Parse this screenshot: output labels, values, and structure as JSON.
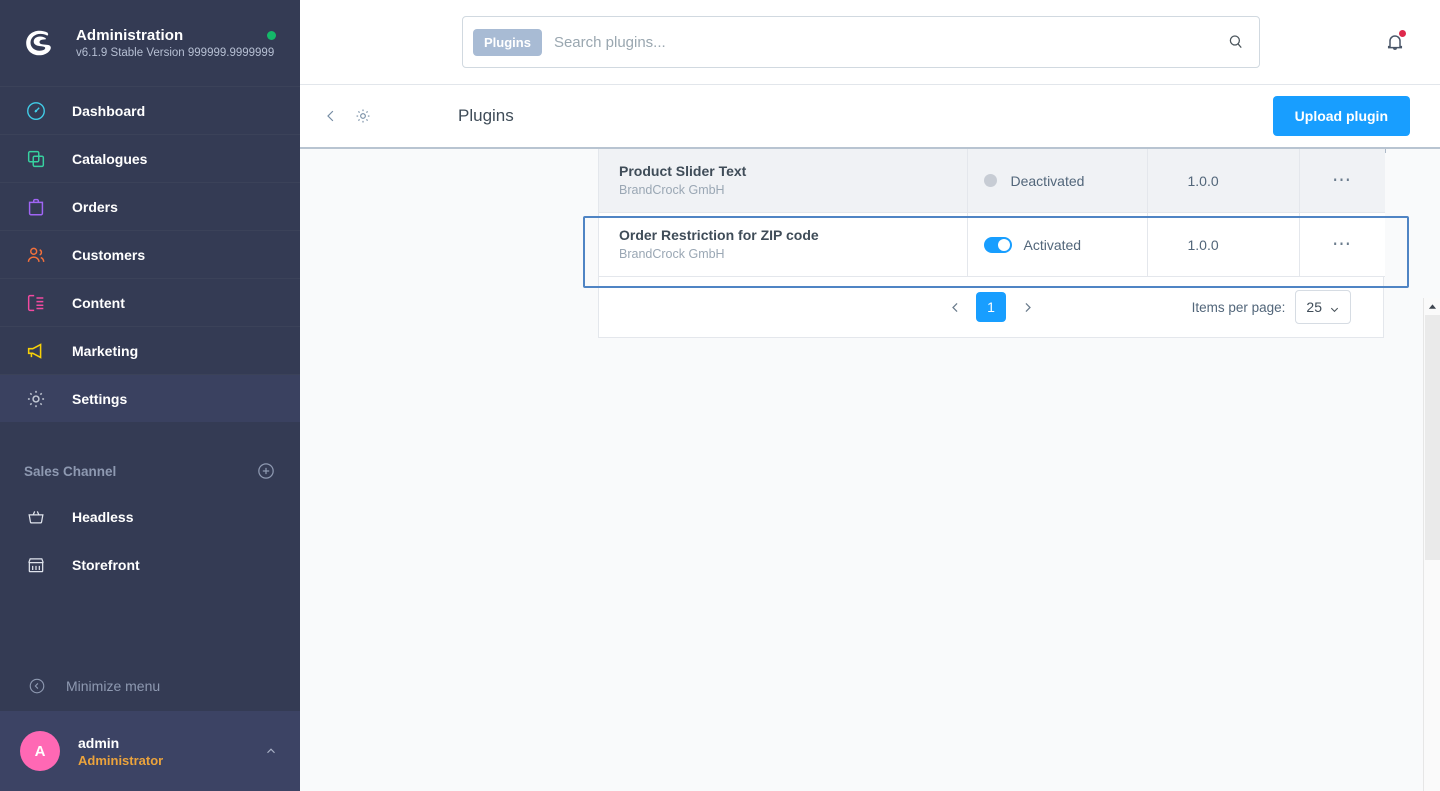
{
  "sidebar": {
    "brand": {
      "title": "Administration",
      "version": "v6.1.9 Stable Version 999999.9999999",
      "logo_icon": "shopware-logo-icon",
      "status_dot_color": "#14b869"
    },
    "nav_items": [
      {
        "label": "Dashboard",
        "icon": "dashboard-icon",
        "color": "#41cde8",
        "active": false
      },
      {
        "label": "Catalogues",
        "icon": "catalogues-icon",
        "color": "#37d1a0",
        "active": false
      },
      {
        "label": "Orders",
        "icon": "orders-icon",
        "color": "#a065f5",
        "active": false
      },
      {
        "label": "Customers",
        "icon": "customers-icon",
        "color": "#f3703b",
        "active": false
      },
      {
        "label": "Content",
        "icon": "content-icon",
        "color": "#f24aa0",
        "active": false
      },
      {
        "label": "Marketing",
        "icon": "marketing-icon",
        "color": "#f7d008",
        "active": false
      },
      {
        "label": "Settings",
        "icon": "gear-icon",
        "color": "#c4cad6",
        "active": true
      }
    ],
    "sales_channel": {
      "heading": "Sales Channel",
      "add_icon": "plus-circle-icon",
      "items": [
        {
          "label": "Headless",
          "icon": "headless-basket-icon"
        },
        {
          "label": "Storefront",
          "icon": "storefront-icon"
        }
      ]
    },
    "minimize": {
      "label": "Minimize menu",
      "icon": "collapse-left-icon"
    },
    "user": {
      "initial": "A",
      "name": "admin",
      "role": "Administrator",
      "chevron_icon": "chevron-up-icon"
    }
  },
  "topbar": {
    "search": {
      "chip_label": "Plugins",
      "placeholder": "Search plugins...",
      "value": "",
      "icon": "search-icon"
    },
    "notifications": {
      "icon": "bell-icon",
      "has_unread": true,
      "dot_color": "#de294c"
    }
  },
  "smartbar": {
    "back_icon": "chevron-left-icon",
    "settings_icon": "gear-icon",
    "title": "Plugins",
    "upload_label": "Upload plugin",
    "accent_color": "#189eff"
  },
  "table": {
    "rows": [
      {
        "name": "Product Slider Text",
        "vendor": "BrandCrock GmbH",
        "status": "Deactivated",
        "active": false,
        "version": "1.0.0",
        "actions_icon": "more-dots-icon",
        "selected": false
      },
      {
        "name": "Order Restriction for ZIP code",
        "vendor": "BrandCrock GmbH",
        "status": "Activated",
        "active": true,
        "version": "1.0.0",
        "actions_icon": "more-dots-icon",
        "selected": true
      }
    ]
  },
  "pagination": {
    "prev_icon": "chevron-left-icon",
    "next_icon": "chevron-right-icon",
    "current_page": "1",
    "items_per_page_label": "Items per page:",
    "items_per_page_value": "25",
    "select_chevron_icon": "chevron-down-icon"
  },
  "scrollbar": {
    "up_arrow_icon": "scroll-up-arrow-icon"
  }
}
